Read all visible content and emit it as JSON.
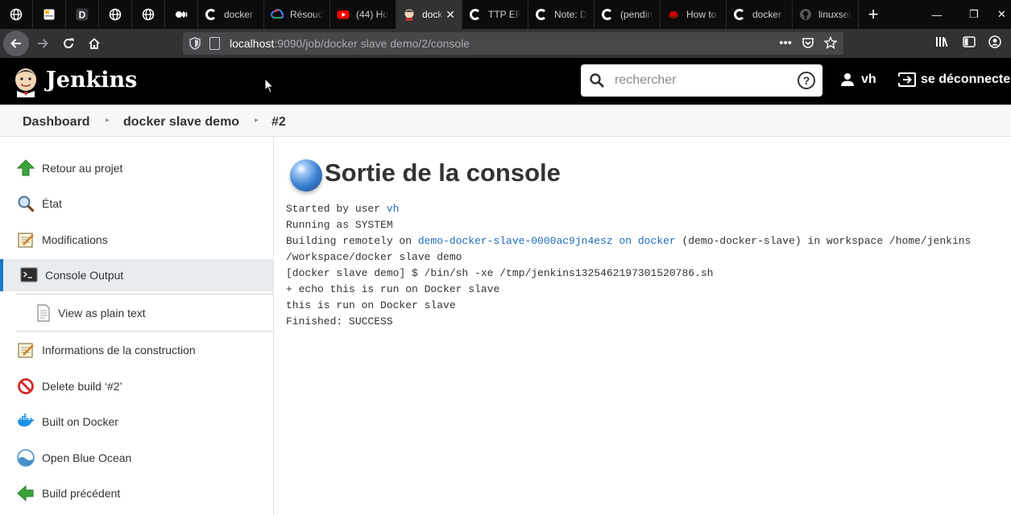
{
  "browser": {
    "tabs": [
      {
        "label": "",
        "icon": "globe-icon",
        "pinned": true
      },
      {
        "label": "",
        "icon": "notes-icon",
        "pinned": true
      },
      {
        "label": "",
        "icon": "d-app-icon",
        "pinned": true
      },
      {
        "label": "",
        "icon": "globe-icon",
        "pinned": true
      },
      {
        "label": "",
        "icon": "globe-icon",
        "pinned": true
      },
      {
        "label": "",
        "icon": "medium-icon",
        "pinned": true
      },
      {
        "label": "docker",
        "icon": "google-icon"
      },
      {
        "label": "Résoud",
        "icon": "gcloud-icon"
      },
      {
        "label": "(44) Ho",
        "icon": "youtube-icon"
      },
      {
        "label": "dock",
        "icon": "jenkins-icon",
        "active": true
      },
      {
        "label": "TTP ERR",
        "icon": "google-icon"
      },
      {
        "label": "Note: D",
        "icon": "google-icon"
      },
      {
        "label": "(pendin",
        "icon": "google-icon"
      },
      {
        "label": "How to",
        "icon": "redhat-icon"
      },
      {
        "label": "docker",
        "icon": "google-icon"
      },
      {
        "label": "linuxser",
        "icon": "github-icon"
      }
    ],
    "new_tab_label": "+",
    "url_host": "localhost",
    "url_rest": ":9090/job/docker slave demo/2/console",
    "colors": {
      "tabstrip": "#0c0c0d",
      "toolbar": "#323234",
      "urlbox": "#474749"
    }
  },
  "jenkins": {
    "title": "Jenkins",
    "search_placeholder": "rechercher",
    "help_label": "?",
    "user": "vh",
    "logout": "se déconnecter"
  },
  "breadcrumb": [
    {
      "label": "Dashboard"
    },
    {
      "label": "docker slave demo"
    },
    {
      "label": "#2"
    }
  ],
  "sidepanel": {
    "items": [
      {
        "label": "Retour au projet",
        "icon": "up-arrow-icon"
      },
      {
        "label": "État",
        "icon": "magnifier-icon"
      },
      {
        "label": "Modifications",
        "icon": "notepad-icon"
      },
      {
        "label": "Console Output",
        "icon": "terminal-icon",
        "active": true
      },
      {
        "label": "View as plain text",
        "icon": "document-icon",
        "sub": true
      },
      {
        "label": "Informations de la construction",
        "icon": "notepad-icon"
      },
      {
        "label": "Delete build ‘#2’",
        "icon": "no-entry-icon"
      },
      {
        "label": "Built on Docker",
        "icon": "docker-icon"
      },
      {
        "label": "Open Blue Ocean",
        "icon": "blue-ocean-icon"
      },
      {
        "label": "Build précédent",
        "icon": "left-arrow-icon"
      }
    ]
  },
  "main": {
    "title": "Sortie de la console",
    "status_color": "#3a7fd0",
    "console": {
      "l1_prefix": "Started by user ",
      "l1_user": "vh",
      "l2": "Running as SYSTEM",
      "l3_prefix": "Building remotely on ",
      "l3_link": "demo-docker-slave-0000ac9jn4esz on docker",
      "l3_suffix": " (demo-docker-slave) in workspace /home/jenkins",
      "l4": "/workspace/docker slave demo",
      "l5": "[docker slave demo] $ /bin/sh -xe /tmp/jenkins1325462197301520786.sh",
      "l6": "+ echo this is run on Docker slave",
      "l7": "this is run on Docker slave",
      "l8": "Finished: SUCCESS"
    }
  }
}
